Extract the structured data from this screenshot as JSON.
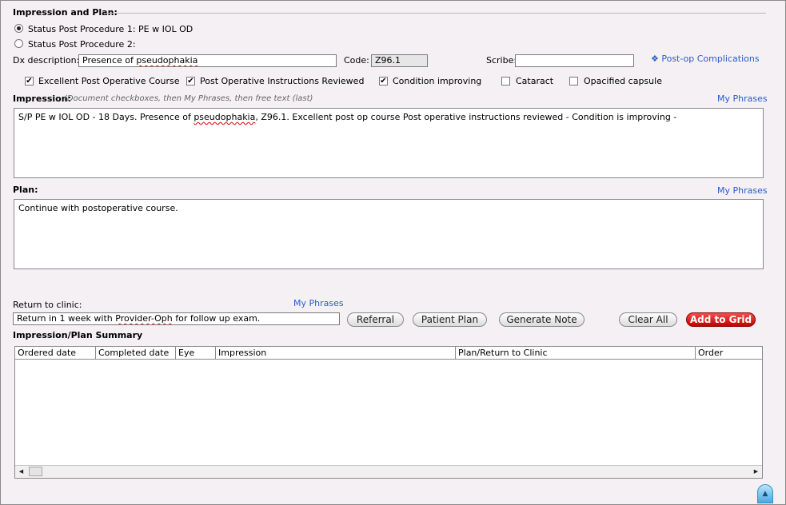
{
  "section_title": "Impression and Plan:",
  "status": {
    "option1": "Status Post Procedure 1:  PE w IOL OD",
    "option2": "Status Post Procedure 2:",
    "selected": 1
  },
  "dx": {
    "label": "Dx description:",
    "value_prefix": "Presence of ",
    "value_misspelled": "pseudophakia",
    "code_label": "Code:",
    "code_value": "Z96.1",
    "scribe_label": "Scribe:",
    "scribe_value": "",
    "complications_link": "❖ Post-op Complications"
  },
  "checkboxes": [
    {
      "label": "Excellent Post Operative Course",
      "checked": true
    },
    {
      "label": "Post Operative Instructions Reviewed",
      "checked": true
    },
    {
      "label": "Condition improving",
      "checked": true
    },
    {
      "label": "Cataract",
      "checked": false
    },
    {
      "label": "Opacified capsule",
      "checked": false
    }
  ],
  "impression": {
    "label": "Impression:",
    "hint": "(Document checkboxes, then My Phrases, then free text (last)",
    "my_phrases": "My Phrases",
    "text_1": "S/P PE w IOL OD - 18 Days. Presence of ",
    "text_misspelled": "pseudophakia",
    "text_2": ", Z96.1. Excellent post op course   Post operative instructions reviewed - Condition is improving -"
  },
  "plan": {
    "label": "Plan:",
    "my_phrases": "My Phrases",
    "text": "Continue with postoperative course."
  },
  "return_clinic": {
    "label": "Return to clinic:",
    "my_phrases": "My Phrases",
    "text_1": "Return in 1 week with ",
    "text_misspelled": "Provider-Oph",
    "text_2": " for follow up exam."
  },
  "buttons": {
    "referral": "Referral",
    "patient_plan": "Patient Plan",
    "generate_note": "Generate Note",
    "clear_all": "Clear All",
    "add_to_grid": "Add to Grid"
  },
  "summary": {
    "title": "Impression/Plan Summary",
    "columns": [
      "Ordered date",
      "Completed date",
      "Eye",
      "Impression",
      "Plan/Return to Clinic",
      "Order"
    ],
    "rows": []
  },
  "scroll_icons": {
    "left": "◀",
    "right": "▶",
    "up": "▲"
  }
}
